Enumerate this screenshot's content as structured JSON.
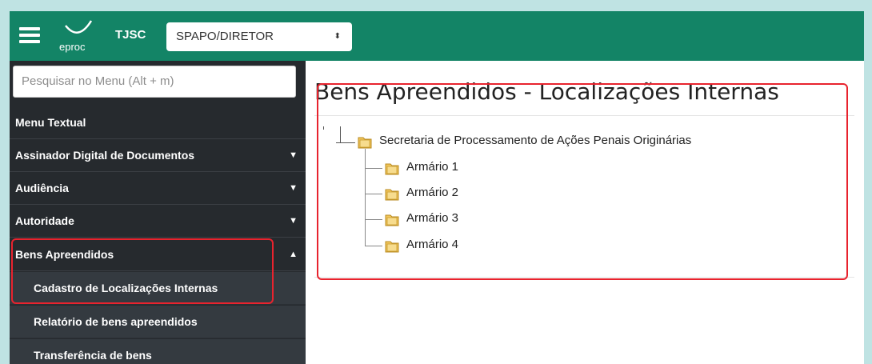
{
  "header": {
    "logo_text": "eproc",
    "org": "TJSC",
    "role_selected": "SPAPO/DIRETOR"
  },
  "sidebar": {
    "search_placeholder": "Pesquisar no Menu (Alt + m)",
    "items": [
      {
        "label": "Menu Textual"
      },
      {
        "label": "Assinador Digital de Documentos"
      },
      {
        "label": "Audiência"
      },
      {
        "label": "Autoridade"
      },
      {
        "label": "Bens Apreendidos"
      }
    ],
    "subitems": [
      {
        "label": "Cadastro de Localizações Internas"
      },
      {
        "label": "Relatório de bens apreendidos"
      },
      {
        "label": "Transferência de bens"
      }
    ]
  },
  "main": {
    "title": "Bens Apreendidos - Localizações Internas",
    "tree": {
      "root": "Secretaria de Processamento de Ações Penais Originárias",
      "children": [
        "Armário 1",
        "Armário 2",
        "Armário 3",
        "Armário 4"
      ]
    }
  },
  "colors": {
    "header_bg": "#138466",
    "sidebar_bg": "#262a2e",
    "highlight": "#e8232e"
  }
}
